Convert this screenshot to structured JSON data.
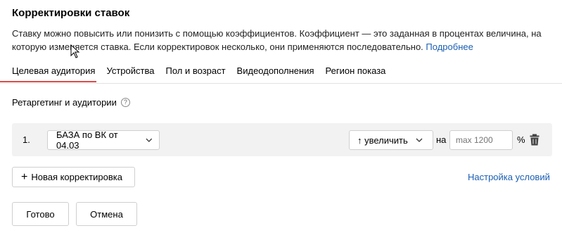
{
  "header": {
    "title": "Корректировки ставок",
    "description": "Ставку можно повысить или понизить с помощью коэффициентов. Коэффициент — это заданная в процентах величина, на которую изменяется ставка. Если корректировок несколько, они применяются последовательно.",
    "more_link": "Подробнее"
  },
  "tabs": [
    {
      "label": "Целевая аудитория",
      "active": true
    },
    {
      "label": "Устройства",
      "active": false
    },
    {
      "label": "Пол и возраст",
      "active": false
    },
    {
      "label": "Видеодополнения",
      "active": false
    },
    {
      "label": "Регион показа",
      "active": false
    }
  ],
  "section": {
    "label": "Ретаргетинг и аудитории",
    "help_icon": "question-circle-icon"
  },
  "adjustment": {
    "number": "1.",
    "audience_value": "БАЗА по ВК от 04.03",
    "direction_value": "↑ увеличить",
    "on_label": "на",
    "input_placeholder": "max 1200",
    "percent_label": "%",
    "delete_icon": "trash-icon"
  },
  "actions": {
    "add_label": "Новая корректировка",
    "conditions_link": "Настройка условий",
    "done_label": "Готово",
    "cancel_label": "Отмена"
  },
  "colors": {
    "accent_red": "#e04a46",
    "link_blue": "#1a5fb4"
  }
}
